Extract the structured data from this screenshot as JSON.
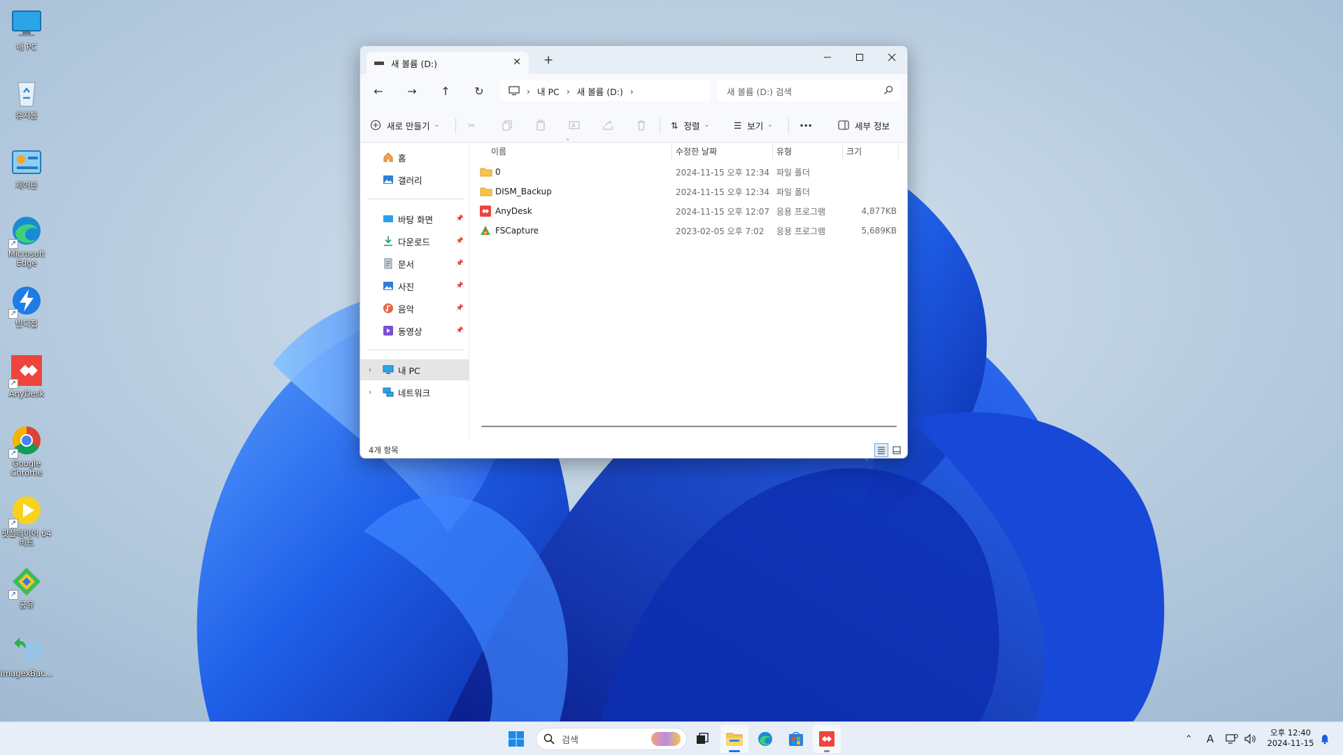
{
  "desktop": {
    "icons": [
      {
        "label": "내 PC",
        "icon": "monitor-icon"
      },
      {
        "label": "휴지통",
        "icon": "recycle-bin-icon"
      },
      {
        "label": "제어판",
        "icon": "control-panel-icon"
      },
      {
        "label": "Microsoft Edge",
        "icon": "edge-icon"
      },
      {
        "label": "반디집",
        "icon": "bandizip-icon"
      },
      {
        "label": "AnyDesk",
        "icon": "anydesk-icon"
      },
      {
        "label": "Google Chrome",
        "icon": "chrome-icon"
      },
      {
        "label": "팟플레이어 64 비트",
        "icon": "potplayer-icon"
      },
      {
        "label": "공유",
        "icon": "share-icon"
      },
      {
        "label": "ImagexBac...",
        "icon": "imagex-icon"
      }
    ]
  },
  "explorer": {
    "tab_title": "새 볼륨 (D:)",
    "address": {
      "part1": "내 PC",
      "part2": "새 볼륨 (D:)"
    },
    "search_placeholder": "새 볼륨 (D:) 검색",
    "commands": {
      "new": "새로 만들기",
      "sort": "정렬",
      "view": "보기",
      "details": "세부 정보"
    },
    "nav": {
      "home": "홈",
      "gallery": "갤러리",
      "desktop": "바탕 화면",
      "downloads": "다운로드",
      "documents": "문서",
      "pictures": "사진",
      "music": "음악",
      "videos": "동영상",
      "this_pc": "내 PC",
      "network": "네트워크"
    },
    "columns": {
      "name": "이름",
      "modified": "수정한 날짜",
      "type": "유형",
      "size": "크기"
    },
    "files": [
      {
        "name": "0",
        "date": "2024-11-15 오후 12:34",
        "type": "파일 폴더",
        "size": "",
        "icon": "folder-icon"
      },
      {
        "name": "DISM_Backup",
        "date": "2024-11-15 오후 12:34",
        "type": "파일 폴더",
        "size": "",
        "icon": "folder-icon"
      },
      {
        "name": "AnyDesk",
        "date": "2024-11-15 오후 12:07",
        "type": "응용 프로그램",
        "size": "4,877KB",
        "icon": "anydesk-icon"
      },
      {
        "name": "FSCapture",
        "date": "2023-02-05 오후 7:02",
        "type": "응용 프로그램",
        "size": "5,689KB",
        "icon": "fscapture-icon"
      }
    ],
    "status": "4개 항목"
  },
  "taskbar": {
    "search_label": "검색",
    "clock_time": "오후 12:40",
    "clock_date": "2024-11-15",
    "ime": "A"
  }
}
